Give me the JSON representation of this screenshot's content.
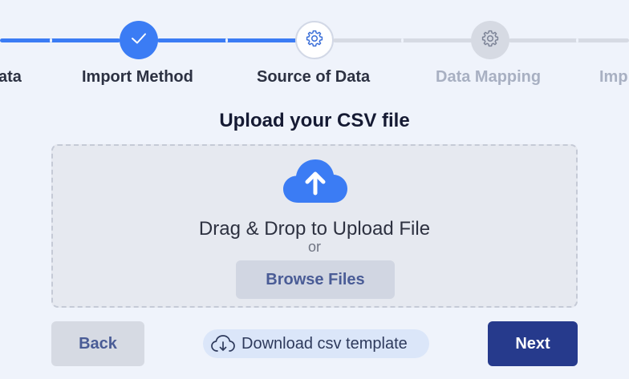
{
  "stepper": {
    "steps": [
      {
        "label": "Data",
        "state": "done"
      },
      {
        "label": "Import Method",
        "state": "done"
      },
      {
        "label": "Source of Data",
        "state": "current"
      },
      {
        "label": "Data Mapping",
        "state": "todo"
      },
      {
        "label": "Import",
        "state": "todo"
      }
    ],
    "visible_labels": {
      "step1": "ata",
      "step2": "Import Method",
      "step3": "Source of Data",
      "step4": "Data Mapping",
      "step5": "Imp"
    },
    "icons": {
      "step2": "check-icon",
      "step3": "gear-icon",
      "step4": "gear-icon"
    }
  },
  "upload": {
    "title": "Upload your CSV file",
    "icon": "cloud-upload-icon",
    "drag_text": "Drag & Drop to Upload File",
    "or_text": "or",
    "browse_label": "Browse Files"
  },
  "footer": {
    "back_label": "Back",
    "template_label": "Download csv template",
    "template_icon": "cloud-download-icon",
    "next_label": "Next"
  },
  "colors": {
    "accent": "#3b7cf4",
    "primary_button": "#263a8c",
    "background": "#eff3fb"
  }
}
